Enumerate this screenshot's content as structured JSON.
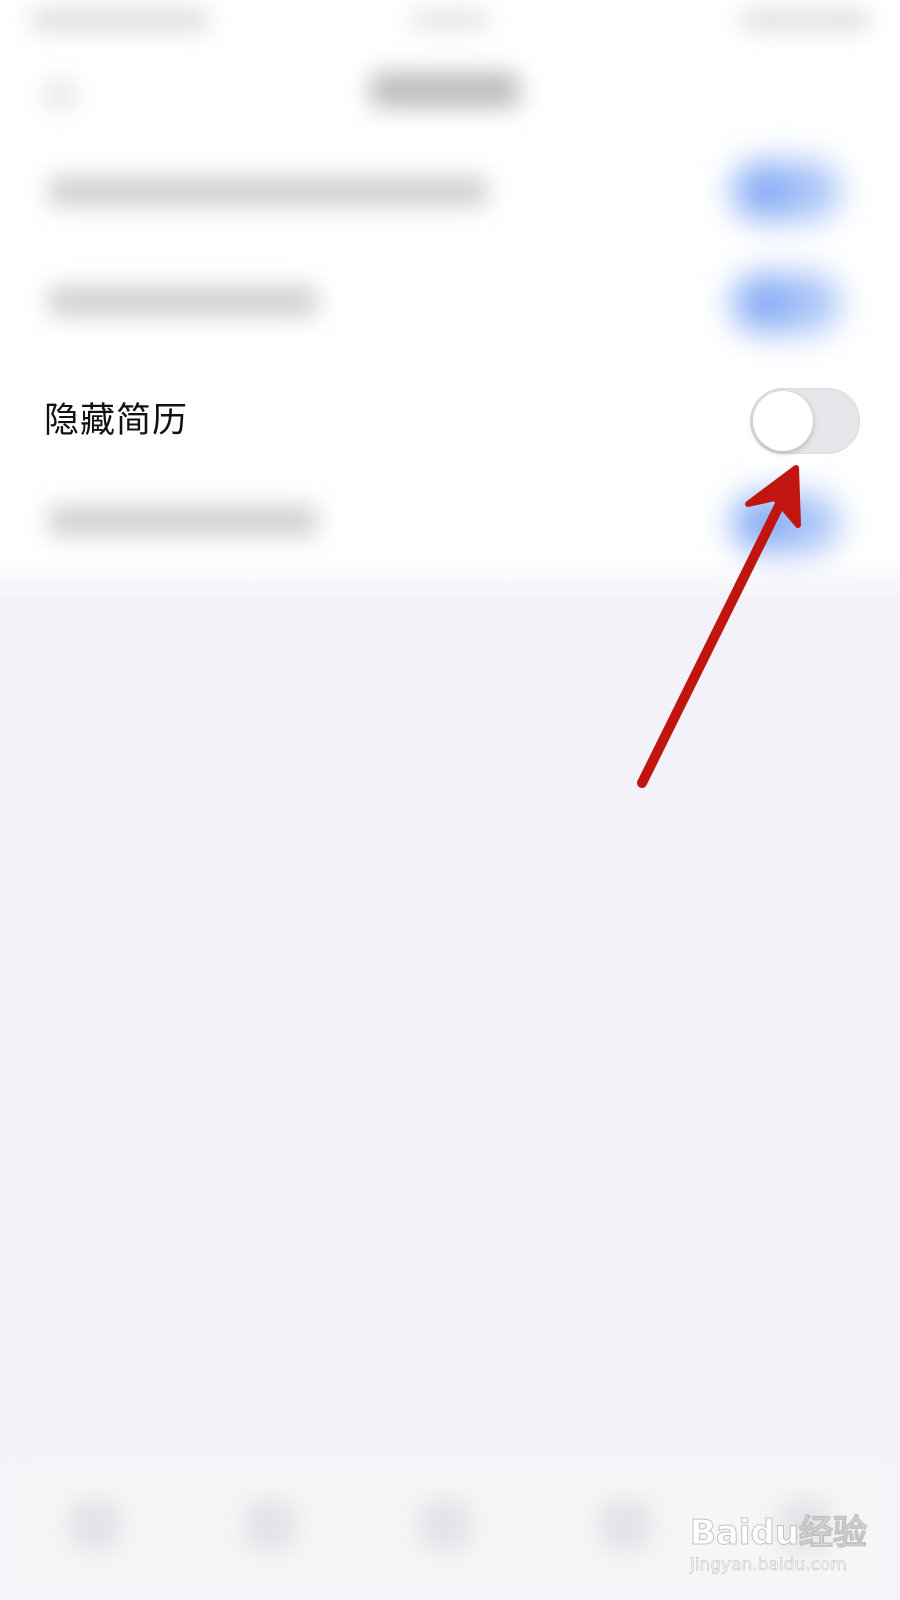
{
  "setting": {
    "label": "隐藏简历",
    "enabled": false
  },
  "colors": {
    "switch_off": "#e5e5ea",
    "blurred_switch_on": "#86abf5",
    "annotation_arrow": "#c0160f",
    "page_background": "#f3f2f8"
  },
  "watermark": {
    "brand": "Baidu经验",
    "url": "jingyan.baidu.com"
  }
}
